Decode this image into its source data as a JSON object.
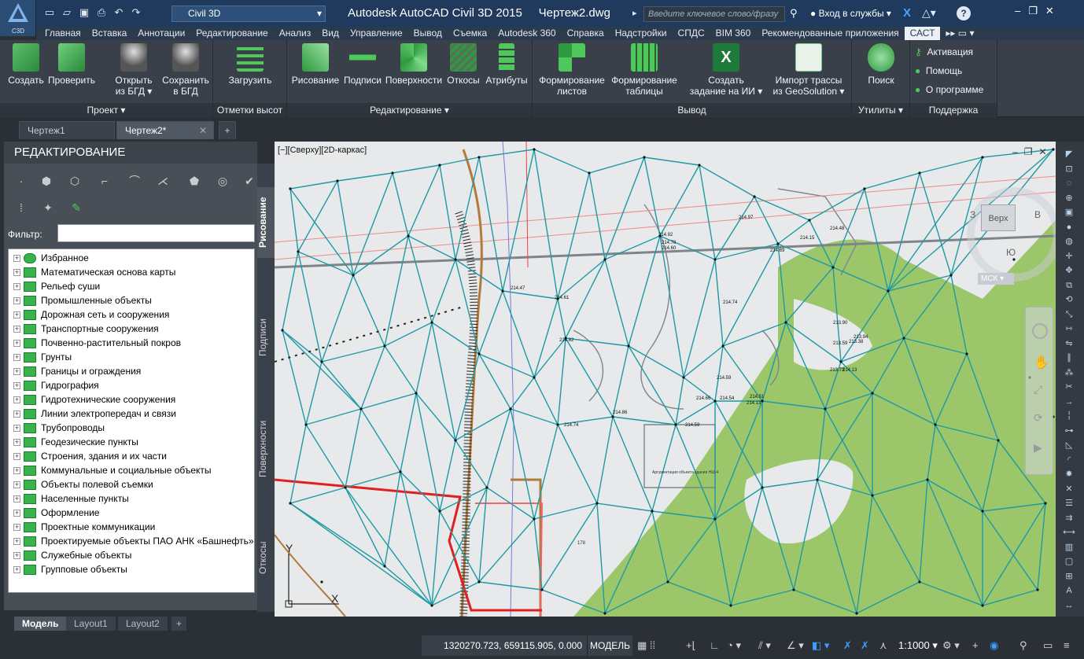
{
  "app": {
    "badge": "C3D",
    "workspace": "Civil 3D",
    "title": "Autodesk AutoCAD Civil 3D 2015",
    "document": "Чертеж2.dwg",
    "search_placeholder": "Введите ключевое слово/фразу",
    "login": "Вход в службы",
    "help": "?"
  },
  "ribbon_tabs": [
    "Главная",
    "Вставка",
    "Аннотации",
    "Редактирование",
    "Анализ",
    "Вид",
    "Управление",
    "Вывод",
    "Съемка",
    "Autodesk 360",
    "Справка",
    "Надстройки",
    "СПДС",
    "BIM 360",
    "Рекомендованные приложения",
    "САСТ"
  ],
  "active_tab": "САСТ",
  "ribbon": {
    "proekt": {
      "title": "Проект ▾",
      "create": "Создать",
      "check": "Проверить",
      "open1": "Открыть",
      "open2": "из БГД ▾",
      "save1": "Сохранить",
      "save2": "в БГД"
    },
    "otmetki": {
      "title": "Отметки высот",
      "load": "Загрузить"
    },
    "redakt": {
      "title": "Редактирование ▾",
      "draw": "Рисование",
      "labels": "Подписи",
      "surfaces": "Поверхности",
      "slopes": "Откосы",
      "attrs": "Атрибуты"
    },
    "vyvod": {
      "title": "Вывод",
      "sheets1": "Формирование",
      "sheets2": "листов",
      "tables1": "Формирование",
      "tables2": "таблицы",
      "task1": "Создать",
      "task2": "задание на ИИ ▾",
      "import1": "Импорт трассы",
      "import2": "из GeoSolution ▾"
    },
    "util": {
      "title": "Утилиты ▾",
      "search": "Поиск"
    },
    "support": {
      "title": "Поддержка",
      "activation": "Активация",
      "help": "Помощь",
      "about": "О программе"
    }
  },
  "doc_tabs": [
    "Чертеж1",
    "Чертеж2*"
  ],
  "palette": {
    "title": "РЕДАКТИРОВАНИЕ",
    "filter_label": "Фильтр:",
    "filter_value": "",
    "side_tabs": [
      "Рисование",
      "Подписи",
      "Поверхности",
      "Откосы"
    ],
    "tree": [
      "Избранное",
      "Математическая основа карты",
      "Рельеф суши",
      "Промышленные объекты",
      "Дорожная сеть и сооружения",
      "Транспортные сооружения",
      "Почвенно-растительный покров",
      "Грунты",
      "Границы и ограждения",
      "Гидрография",
      "Гидротехнические сооружения",
      "Линии электропередач и связи",
      "Трубопроводы",
      "Геодезические пункты",
      "Строения, здания и их части",
      "Коммунальные и социальные объекты",
      "Объекты полевой съемки",
      "Населенные пункты",
      "Оформление",
      "Проектные коммуникации",
      "Проектируемые объекты ПАО АНК «Башнефть»",
      "Служебные объекты",
      "Групповые объекты"
    ]
  },
  "viewport": {
    "label": "[−][Сверху][2D-каркас]",
    "viewcube_top": "Верх",
    "viewcube_w": "З",
    "viewcube_e": "В",
    "viewcube_s": "Ю",
    "ucs_label": "МСК",
    "axis_x": "X",
    "axis_y": "Y",
    "spot_labels": [
      "214.92",
      "214.78",
      "214.60",
      "214.97",
      "214.15",
      "214.48",
      "214.69",
      "214.47",
      "214.61",
      "214.74",
      "214.82",
      "213.90",
      "213.59",
      "213.38",
      "213.94",
      "214.59",
      "214.66",
      "214.54",
      "214.13",
      "214.51",
      "214.74",
      "214.86",
      "214.59",
      "213.73",
      "214.13",
      "178"
    ],
    "surface_note": "Аргументация объекта здания НШ-4",
    "colors": {
      "tin": "#1e9aa4",
      "vegetation": "#9cc66a",
      "redline": "#e02020",
      "road": "#b07a3a"
    }
  },
  "layout_tabs": [
    "Модель",
    "Layout1",
    "Layout2"
  ],
  "status": {
    "coords": "1320270.723, 659115.905, 0.000",
    "model": "МОДЕЛЬ",
    "scale": "1:1000 ▾"
  }
}
